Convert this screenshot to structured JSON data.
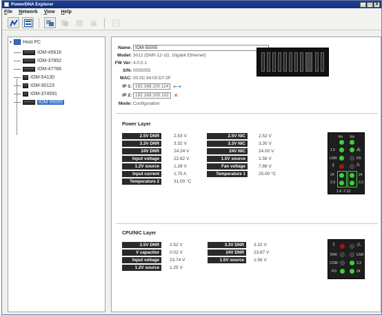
{
  "window": {
    "title": "PowerDNA Explorer",
    "buttons": [
      "_",
      "□",
      "X"
    ]
  },
  "menu": [
    "File",
    "Network",
    "View",
    "Help"
  ],
  "toolbar": {
    "icons": [
      "device-view-icon",
      "list-icon",
      "refresh-icon",
      "copy-icon",
      "export-icon",
      "lock-icon",
      "settings-icon"
    ]
  },
  "tree": {
    "root": "Host PC",
    "items": [
      "IOM-45616",
      "IOM-37852",
      "IOM-47766",
      "IOM-54130",
      "IOM-30123",
      "IOM-374591",
      "IOM-55055"
    ],
    "selected": "IOM-55055"
  },
  "device": {
    "name_label": "Name:",
    "name_value": "IOM-55055",
    "model_label": "Model:",
    "model_value": "3012 (DNR-12-1G, Gigabit Ethernet)",
    "fw_label": "FW Ver:",
    "fw_value": "4.0.0.1",
    "sn_label": "S/N:",
    "sn_value": "0055055",
    "mac_label": "MAC:",
    "mac_value": "00:0C:94:00:D7:0F",
    "ip1_label": "IP 1:",
    "ip1_value": "192.168.100.114",
    "ip1_icon": "⟷",
    "ip2_label": "IP 2:",
    "ip2_value": "192.168.100.102",
    "ip2_icon": "✕",
    "mode_label": "Mode:",
    "mode_value": "Configuration"
  },
  "power": {
    "title": "Power Layer",
    "left": [
      {
        "label": "2.5V DNR",
        "value": "2.53 V"
      },
      {
        "label": "3.3V DNR",
        "value": "3.32 V"
      },
      {
        "label": "24V DNR",
        "value": "24.24 V"
      },
      {
        "label": "Input voltage",
        "value": "22.62 V"
      },
      {
        "label": "1.2V source",
        "value": "1.28 V"
      },
      {
        "label": "Input current",
        "value": "1.75 A"
      },
      {
        "label": "Temperature 2",
        "value": "31.00 °C"
      }
    ],
    "right": [
      {
        "label": "2.5V NIC",
        "value": "2.52 V"
      },
      {
        "label": "3.3V NIC",
        "value": "3.30 V"
      },
      {
        "label": "24V NIC",
        "value": "24.00 V"
      },
      {
        "label": "1.5V source",
        "value": "1.56 V"
      },
      {
        "label": "Fan voltage",
        "value": "7.88 V"
      },
      {
        "label": "Temperature 1",
        "value": "25.00 °C"
      }
    ],
    "panel": {
      "vin": "Vin",
      "vin2": "Vin",
      "r15": "1.5",
      "usr": "USR",
      "io": "I/O",
      "r24": "24",
      "r24b": "24",
      "r33": "3.3",
      "r33b": "3.3",
      "foot": "1-6  -7-12"
    }
  },
  "cpu": {
    "title": "CPU/NIC Layer",
    "left": [
      {
        "label": "2.5V DNR",
        "value": "2.52 V"
      },
      {
        "label": "V capacitor",
        "value": "0.02 V"
      },
      {
        "label": "Input voltage",
        "value": "23.74 V"
      },
      {
        "label": "1.2V source",
        "value": "1.25 V"
      }
    ],
    "right": [
      {
        "label": "3.3V DNR",
        "value": "3.32 V"
      },
      {
        "label": "24V DNR",
        "value": "23.87 V"
      },
      {
        "label": "1.5V source",
        "value": "1.56 V"
      }
    ],
    "panel": {
      "rw": "R/W",
      "usr": "USR",
      "com": "COM",
      "r33": "3.3",
      "pd": "PD",
      "r24": "24"
    }
  }
}
